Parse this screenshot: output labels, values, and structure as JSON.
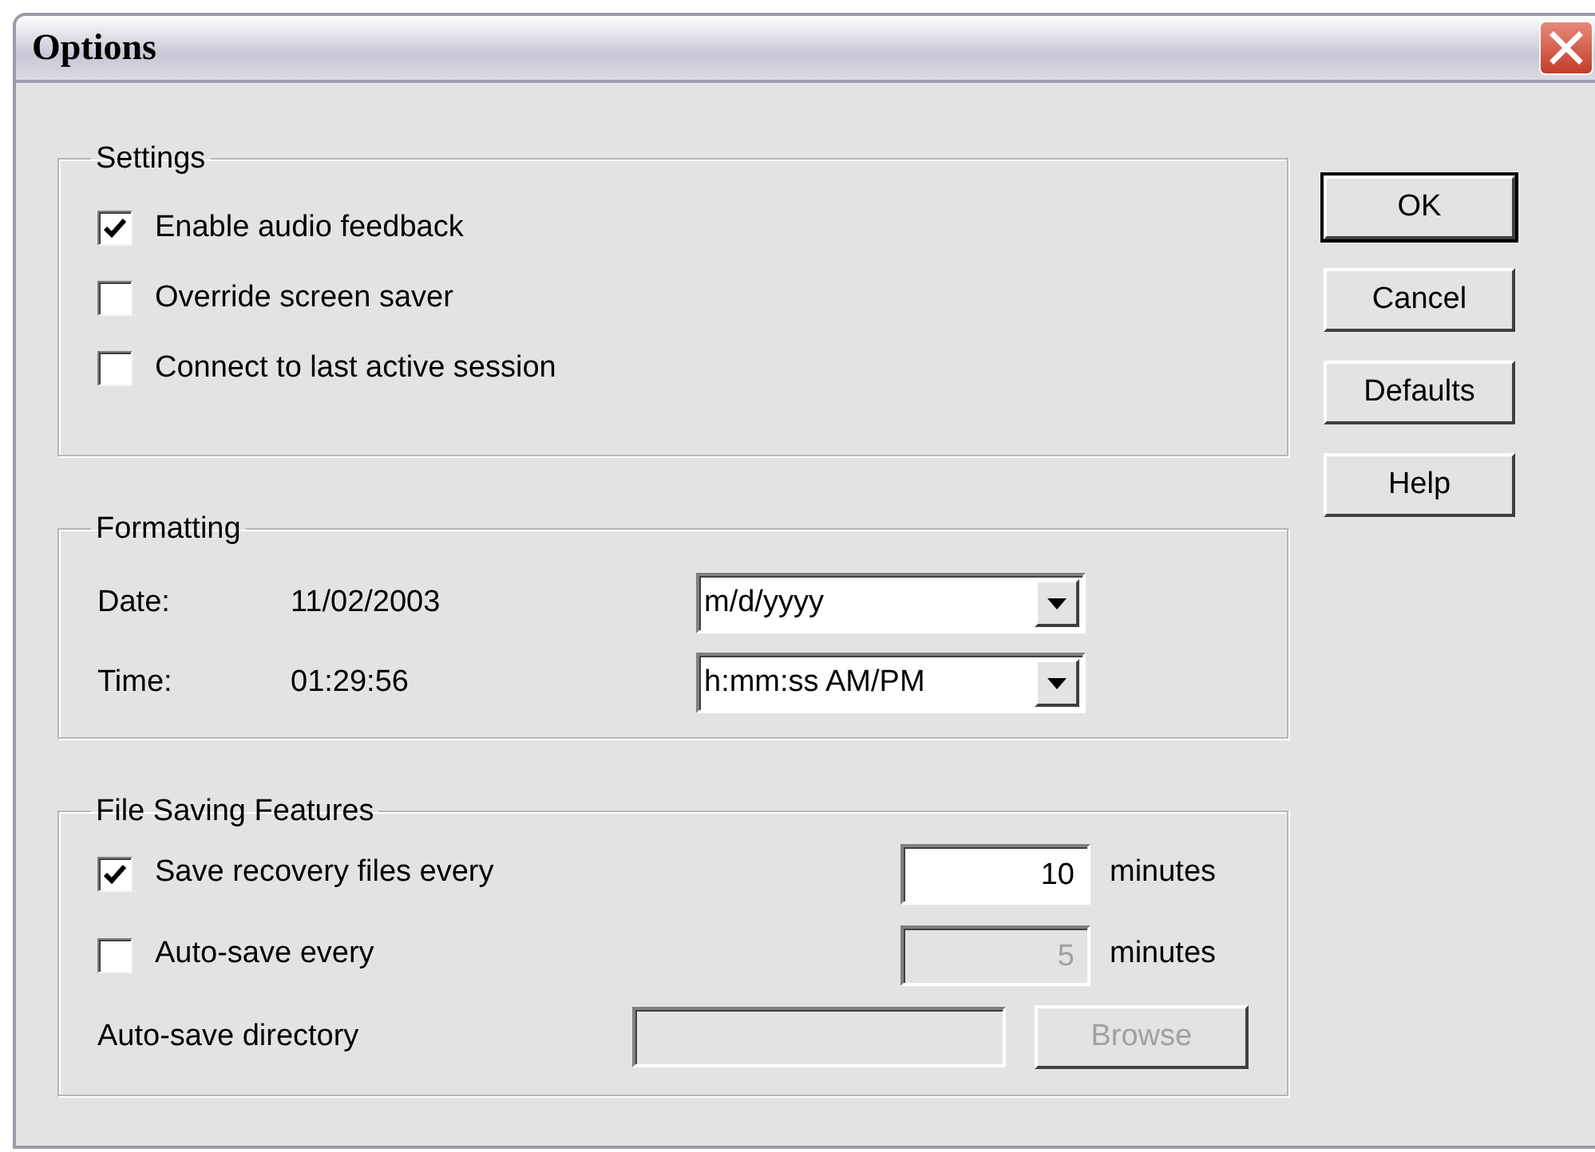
{
  "window": {
    "title": "Options"
  },
  "settings": {
    "title": "Settings",
    "options": [
      {
        "label": "Enable audio feedback",
        "checked": true
      },
      {
        "label": "Override screen saver",
        "checked": false
      },
      {
        "label": "Connect to last active session",
        "checked": false
      }
    ]
  },
  "formatting": {
    "title": "Formatting",
    "rows": [
      {
        "label": "Date:",
        "value": "11/02/2003",
        "format": "m/d/yyyy"
      },
      {
        "label": "Time:",
        "value": "01:29:56",
        "format": "h:mm:ss AM/PM"
      }
    ]
  },
  "file_saving": {
    "title": "File Saving Features",
    "intervals": [
      {
        "label": "Save recovery files every",
        "checked": true,
        "value": "10",
        "unit": "minutes",
        "disabled": false
      },
      {
        "label": "Auto-save every",
        "checked": false,
        "value": "5",
        "unit": "minutes",
        "disabled": true
      }
    ],
    "directory": {
      "label": "Auto-save directory",
      "button": "Browse",
      "disabled": true
    }
  },
  "buttons": [
    {
      "label": "OK",
      "default": true
    },
    {
      "label": "Cancel",
      "default": false
    },
    {
      "label": "Defaults",
      "default": false
    },
    {
      "label": "Help",
      "default": false
    }
  ]
}
